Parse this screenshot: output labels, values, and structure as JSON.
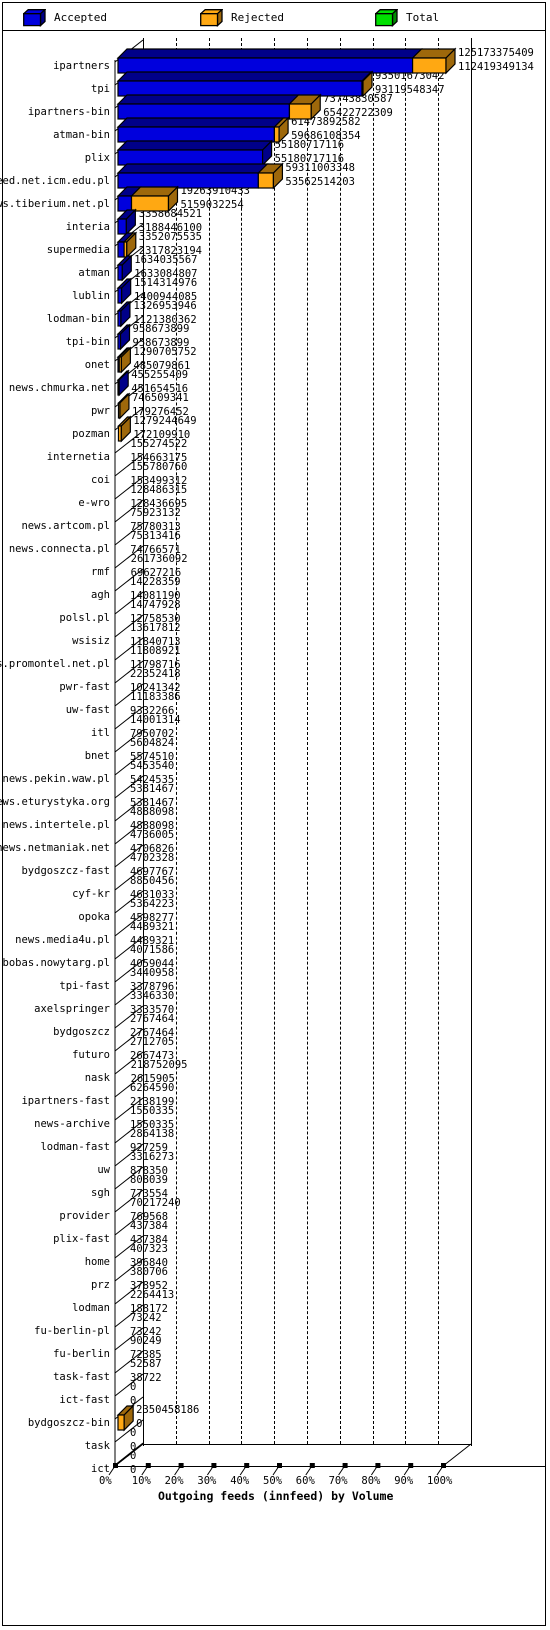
{
  "legend": {
    "items": [
      {
        "label": "Accepted",
        "color": "#0000dd",
        "icon": "cube-icon"
      },
      {
        "label": "Rejected",
        "color": "#ffa812",
        "icon": "cube-icon"
      },
      {
        "label": "Total",
        "color": "#00e000",
        "icon": "cube-icon"
      }
    ]
  },
  "axis": {
    "title": "Outgoing feeds (innfeed) by Volume",
    "ticks": [
      "0%",
      "10%",
      "20%",
      "30%",
      "40%",
      "50%",
      "60%",
      "70%",
      "80%",
      "90%",
      "100%"
    ]
  },
  "chart_data": {
    "type": "bar",
    "orientation": "horizontal",
    "title": "Outgoing feeds (innfeed) by Volume",
    "xlabel": "Outgoing feeds (innfeed) by Volume",
    "ylabel": "",
    "xlim": [
      0,
      100
    ],
    "xtick_labels": [
      "0%",
      "10%",
      "20%",
      "30%",
      "40%",
      "50%",
      "60%",
      "70%",
      "80%",
      "90%",
      "100%"
    ],
    "grid": true,
    "legend_position": "top",
    "normalization": "percent of maximum total (125173375409)",
    "max_total": 125173375409,
    "series": [
      {
        "name": "Accepted",
        "color": "#0000dd"
      },
      {
        "name": "Rejected",
        "color": "#ffa812"
      },
      {
        "name": "Total",
        "color": "#00e000"
      }
    ],
    "categories": [
      "ipartners",
      "tpi",
      "ipartners-bin",
      "atman-bin",
      "plix",
      "newsfeed.net.icm.edu.pl",
      "news.tiberium.net.pl",
      "interia",
      "supermedia",
      "atman",
      "lublin",
      "lodman-bin",
      "tpi-bin",
      "onet",
      "news.chmurka.net",
      "pwr",
      "pozman",
      "internetia",
      "coi",
      "e-wro",
      "news.artcom.pl",
      "news.connecta.pl",
      "rmf",
      "agh",
      "polsl.pl",
      "wsisiz",
      "news.promontel.net.pl",
      "pwr-fast",
      "uw-fast",
      "itl",
      "bnet",
      "news.pekin.waw.pl",
      "news.eturystyka.org",
      "news.intertele.pl",
      "news.netmaniak.net",
      "bydgoszcz-fast",
      "cyf-kr",
      "opoka",
      "news.media4u.pl",
      "bobas.nowytarg.pl",
      "tpi-fast",
      "axelspringer",
      "bydgoszcz",
      "futuro",
      "nask",
      "ipartners-fast",
      "news-archive",
      "lodman-fast",
      "uw",
      "sgh",
      "provider",
      "plix-fast",
      "home",
      "prz",
      "lodman",
      "fu-berlin-pl",
      "fu-berlin",
      "task-fast",
      "ict-fast",
      "bydgoszcz-bin",
      "task",
      "ict"
    ],
    "rows": [
      {
        "category": "ipartners",
        "total": 125173375409,
        "accepted": 112419349134
      },
      {
        "category": "tpi",
        "total": 93501673042,
        "accepted": 93119548347
      },
      {
        "category": "ipartners-bin",
        "total": 73743830587,
        "accepted": 65422722309
      },
      {
        "category": "atman-bin",
        "total": 61473892582,
        "accepted": 59686108354
      },
      {
        "category": "plix",
        "total": 55180717116,
        "accepted": 55180717116
      },
      {
        "category": "newsfeed.net.icm.edu.pl",
        "total": 59311003348,
        "accepted": 53562514203
      },
      {
        "category": "news.tiberium.net.pl",
        "total": 19263910433,
        "accepted": 5159032254
      },
      {
        "category": "interia",
        "total": 3358684521,
        "accepted": 3188446100
      },
      {
        "category": "supermedia",
        "total": 3352075535,
        "accepted": 2317823194
      },
      {
        "category": "atman",
        "total": 1634035567,
        "accepted": 1633084807
      },
      {
        "category": "lublin",
        "total": 1514314976,
        "accepted": 1400944085
      },
      {
        "category": "lodman-bin",
        "total": 1326953946,
        "accepted": 1121380362
      },
      {
        "category": "tpi-bin",
        "total": 958673899,
        "accepted": 958673899
      },
      {
        "category": "onet",
        "total": 1290705752,
        "accepted": 485079861
      },
      {
        "category": "news.chmurka.net",
        "total": 455255409,
        "accepted": 451654516
      },
      {
        "category": "pwr",
        "total": 746509341,
        "accepted": 179276452
      },
      {
        "category": "pozman",
        "total": 1279244649,
        "accepted": 172109910
      },
      {
        "category": "internetia",
        "total": 155274522,
        "accepted": 154663175
      },
      {
        "category": "coi",
        "total": 155780760,
        "accepted": 153499312
      },
      {
        "category": "e-wro",
        "total": 128486315,
        "accepted": 128436695
      },
      {
        "category": "news.artcom.pl",
        "total": 75923132,
        "accepted": 75780313
      },
      {
        "category": "news.connecta.pl",
        "total": 75313416,
        "accepted": 74766571
      },
      {
        "category": "rmf",
        "total": 261736092,
        "accepted": 69627216
      },
      {
        "category": "agh",
        "total": 14228359,
        "accepted": 14081190
      },
      {
        "category": "polsl.pl",
        "total": 14747928,
        "accepted": 12758530
      },
      {
        "category": "wsisiz",
        "total": 13617812,
        "accepted": 11840713
      },
      {
        "category": "news.promontel.net.pl",
        "total": 11808921,
        "accepted": 11798716
      },
      {
        "category": "pwr-fast",
        "total": 22352418,
        "accepted": 10241342
      },
      {
        "category": "uw-fast",
        "total": 11183386,
        "accepted": 9332266
      },
      {
        "category": "itl",
        "total": 14001314,
        "accepted": 7950702
      },
      {
        "category": "bnet",
        "total": 5604824,
        "accepted": 5574510
      },
      {
        "category": "news.pekin.waw.pl",
        "total": 5453540,
        "accepted": 5424535
      },
      {
        "category": "news.eturystyka.org",
        "total": 5381467,
        "accepted": 5381467
      },
      {
        "category": "news.intertele.pl",
        "total": 4888098,
        "accepted": 4888098
      },
      {
        "category": "news.netmaniak.net",
        "total": 4736005,
        "accepted": 4706826
      },
      {
        "category": "bydgoszcz-fast",
        "total": 4702328,
        "accepted": 4697767
      },
      {
        "category": "cyf-kr",
        "total": 8850456,
        "accepted": 4631033
      },
      {
        "category": "opoka",
        "total": 5364223,
        "accepted": 4598277
      },
      {
        "category": "news.media4u.pl",
        "total": 4489321,
        "accepted": 4489321
      },
      {
        "category": "bobas.nowytarg.pl",
        "total": 4071586,
        "accepted": 4059044
      },
      {
        "category": "tpi-fast",
        "total": 3440958,
        "accepted": 3378796
      },
      {
        "category": "axelspringer",
        "total": 3346330,
        "accepted": 3333570
      },
      {
        "category": "bydgoszcz",
        "total": 2767464,
        "accepted": 2767464
      },
      {
        "category": "futuro",
        "total": 2712705,
        "accepted": 2667473
      },
      {
        "category": "nask",
        "total": 218752095,
        "accepted": 2615905
      },
      {
        "category": "ipartners-fast",
        "total": 6264590,
        "accepted": 2138199
      },
      {
        "category": "news-archive",
        "total": 1550335,
        "accepted": 1550335
      },
      {
        "category": "lodman-fast",
        "total": 2864138,
        "accepted": 927259
      },
      {
        "category": "uw",
        "total": 3316273,
        "accepted": 878350
      },
      {
        "category": "sgh",
        "total": 808039,
        "accepted": 773554
      },
      {
        "category": "provider",
        "total": 70217240,
        "accepted": 769568
      },
      {
        "category": "plix-fast",
        "total": 437384,
        "accepted": 437384
      },
      {
        "category": "home",
        "total": 407323,
        "accepted": 396840
      },
      {
        "category": "prz",
        "total": 380706,
        "accepted": 378952
      },
      {
        "category": "lodman",
        "total": 2264413,
        "accepted": 188172
      },
      {
        "category": "fu-berlin-pl",
        "total": 73242,
        "accepted": 73242
      },
      {
        "category": "fu-berlin",
        "total": 90249,
        "accepted": 72385
      },
      {
        "category": "task-fast",
        "total": 52587,
        "accepted": 38722
      },
      {
        "category": "ict-fast",
        "total": 0,
        "accepted": 0
      },
      {
        "category": "bydgoszcz-bin",
        "total": 2350458186,
        "accepted": 0
      },
      {
        "category": "task",
        "total": 0,
        "accepted": 0
      },
      {
        "category": "ict",
        "total": 0,
        "accepted": 0
      }
    ]
  }
}
